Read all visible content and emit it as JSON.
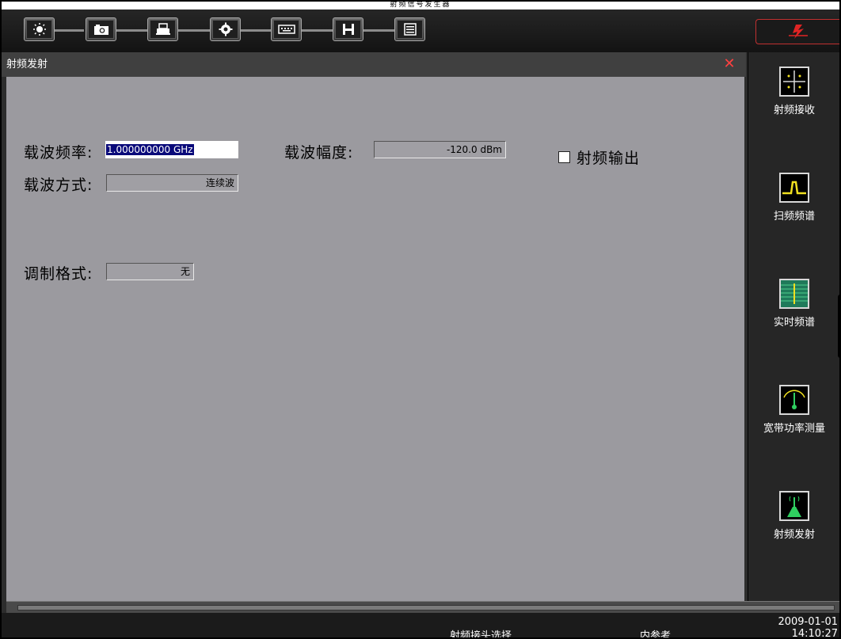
{
  "window": {
    "title": "射频信号发生器"
  },
  "toolbar": {
    "buttons": [
      {
        "icon": "brightness-icon",
        "glyph": "☀"
      },
      {
        "icon": "camera-icon",
        "glyph": "◙"
      },
      {
        "icon": "printer-icon",
        "glyph": "▦"
      },
      {
        "icon": "gear-icon",
        "glyph": "✹"
      },
      {
        "icon": "keyboard-icon",
        "glyph": "⌨"
      },
      {
        "icon": "save-icon",
        "glyph": "▣"
      },
      {
        "icon": "notes-icon",
        "glyph": "☰"
      }
    ],
    "brand_icon": "lightning-logo-icon"
  },
  "panel": {
    "title": "射频发射",
    "carrier_freq": {
      "label": "载波频率:",
      "value": "1.000000000 GHz"
    },
    "carrier_amp": {
      "label": "载波幅度:",
      "value": "-120.0 dBm"
    },
    "rf_output": {
      "label": "射频输出",
      "checked": false
    },
    "carrier_mode": {
      "label": "载波方式:",
      "value": "连续波"
    },
    "modulation": {
      "label": "调制格式:",
      "value": "无"
    }
  },
  "sidebar": {
    "items": [
      {
        "label": "射频接收",
        "icon": "rf-receive-icon"
      },
      {
        "label": "扫频频谱",
        "icon": "sweep-spectrum-icon"
      },
      {
        "label": "实时频谱",
        "icon": "realtime-spectrum-icon"
      },
      {
        "label": "宽带功率测量",
        "icon": "broadband-power-icon"
      },
      {
        "label": "射频发射",
        "icon": "rf-transmit-icon"
      }
    ]
  },
  "status": {
    "rf_connector": "射频接头选择",
    "reference": "内参考",
    "date": "2009-01-01",
    "time": "14:10:27"
  },
  "colors": {
    "panel_bg": "#9b9a9f",
    "header_bg": "#404040",
    "toolbar_bg": "#1c1c1c",
    "selection": "#0a0a7a",
    "close": "#ff4040"
  }
}
